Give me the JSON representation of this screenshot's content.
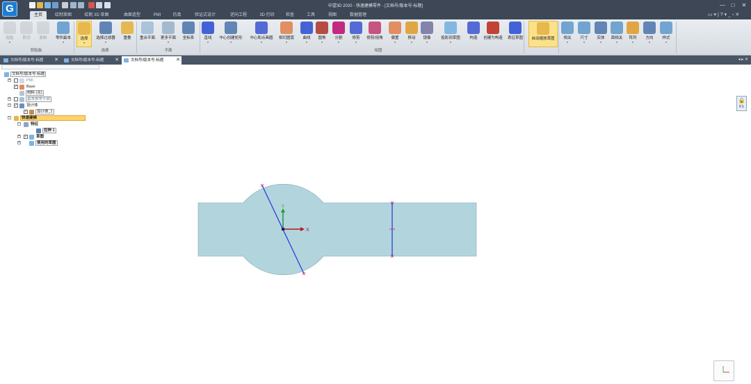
{
  "app": {
    "logo_glyph": "G",
    "window_title": "中望3D 2020 - 快速建模零件 - [文档号/版本号-标题]",
    "window_controls": [
      "—",
      "□",
      "✕"
    ]
  },
  "ribbon_tabs": [
    {
      "label": "主页",
      "active": true
    },
    {
      "label": "绘制草图"
    },
    {
      "label": "绘制 3D 草图"
    },
    {
      "label": "曲面造型"
    },
    {
      "label": "PMI"
    },
    {
      "label": "仿真"
    },
    {
      "label": "验证式设计"
    },
    {
      "label": "逆向工程"
    },
    {
      "label": "3D 打印"
    },
    {
      "label": "检查"
    },
    {
      "label": "工具"
    },
    {
      "label": "视图"
    },
    {
      "label": "数据管理"
    }
  ],
  "ribbon_tab_tools": "▭ ▾ | ? ▾ _ ▫ ✕",
  "ribbon": {
    "buttons": [
      {
        "label": "粘贴",
        "icon": "paste-icon",
        "disabled": true,
        "arrow": true
      },
      {
        "label": "剪切",
        "icon": "cut-icon",
        "disabled": true
      },
      {
        "label": "复制",
        "icon": "copy-icon",
        "disabled": true
      },
      {
        "label": "零件副本",
        "icon": "part-copy-icon",
        "arrow": true
      },
      {
        "label": "选择",
        "icon": "select-cursor-icon",
        "selected": true,
        "arrow": true
      },
      {
        "label": "选择过滤器",
        "icon": "filter-icon",
        "arrow": true
      },
      {
        "label": "重叠",
        "icon": "overlap-icon"
      },
      {
        "label": "重合平面",
        "icon": "coincident-plane-icon"
      },
      {
        "label": "更多平面",
        "icon": "more-planes-icon",
        "arrow": true
      },
      {
        "label": "坐标系",
        "icon": "coordinate-system-icon"
      },
      {
        "label": "直线",
        "icon": "line-icon",
        "arrow": true
      },
      {
        "label": "中心创建矩形",
        "icon": "center-rectangle-icon",
        "arrow": true
      },
      {
        "label": "中心和点画圆",
        "icon": "circle-icon",
        "arrow": true
      },
      {
        "label": "相切圆弧",
        "icon": "tangent-arc-icon",
        "arrow": true
      },
      {
        "label": "曲线",
        "icon": "curve-icon",
        "arrow": true
      },
      {
        "label": "圆角",
        "icon": "fillet-icon",
        "arrow": true
      },
      {
        "label": "分割",
        "icon": "split-icon",
        "arrow": true
      },
      {
        "label": "修剪",
        "icon": "trim-icon",
        "arrow": true
      },
      {
        "label": "修剪/拐角",
        "icon": "trim-corner-icon"
      },
      {
        "label": "偏置",
        "icon": "offset-icon",
        "arrow": true
      },
      {
        "label": "移动",
        "icon": "move-icon",
        "arrow": true
      },
      {
        "label": "镜像",
        "icon": "mirror-icon",
        "arrow": true
      },
      {
        "label": "投影到草图",
        "icon": "project-icon",
        "arrow": true
      },
      {
        "label": "构造",
        "icon": "construct-icon"
      },
      {
        "label": "创建为构造",
        "icon": "to-construction-icon"
      },
      {
        "label": "表征草图",
        "icon": "sketch-icon"
      },
      {
        "label": "自动缩放草图",
        "icon": "auto-scale-icon",
        "selected": true
      },
      {
        "label": "相关",
        "icon": "relation-icon",
        "arrow": true
      },
      {
        "label": "尺寸",
        "icon": "dimension-icon",
        "arrow": true
      },
      {
        "label": "实体",
        "icon": "entity-icon",
        "arrow": true
      },
      {
        "label": "面相关",
        "icon": "face-relation-icon",
        "arrow": true
      },
      {
        "label": "阵列",
        "icon": "pattern-icon",
        "arrow": true
      },
      {
        "label": "方向",
        "icon": "direction-icon",
        "arrow": true
      },
      {
        "label": "样式",
        "icon": "style-icon",
        "arrow": true
      }
    ],
    "groups": [
      "剪贴板",
      "选择",
      "平面",
      "绘图"
    ]
  },
  "doc_tabs": [
    {
      "label": "文档号/版本号-标题",
      "active": false
    },
    {
      "label": "文档号/版本号-标题",
      "active": false
    },
    {
      "label": "文档号/版本号-标题",
      "active": true
    }
  ],
  "doc_tab_nav": "◂ ▸ ✕",
  "tree": {
    "root": "文档号/版本号-标题",
    "pmi": "PMI",
    "base": "Base",
    "material": "材料 (无)",
    "ref_plane": "基本参考平面",
    "design_body": "设计体",
    "design_body_child": "设计体_1",
    "quick_model": "快速建模",
    "features": "特征",
    "extrude": "拉伸 1",
    "sketch": "草图",
    "used_sketch": "使用的草图"
  },
  "lock": {
    "icon": "lock-icon",
    "label": "F1"
  },
  "sketch": {
    "axis_x_label": "X",
    "axis_y_label": "Y",
    "colors": {
      "fill": "#b2d4dd",
      "stroke": "#86a9b3",
      "line": "#2d3fd8",
      "axis_x": "#b2191b",
      "axis_y": "#1f9a3a",
      "endpoint": "#c0207a"
    }
  }
}
